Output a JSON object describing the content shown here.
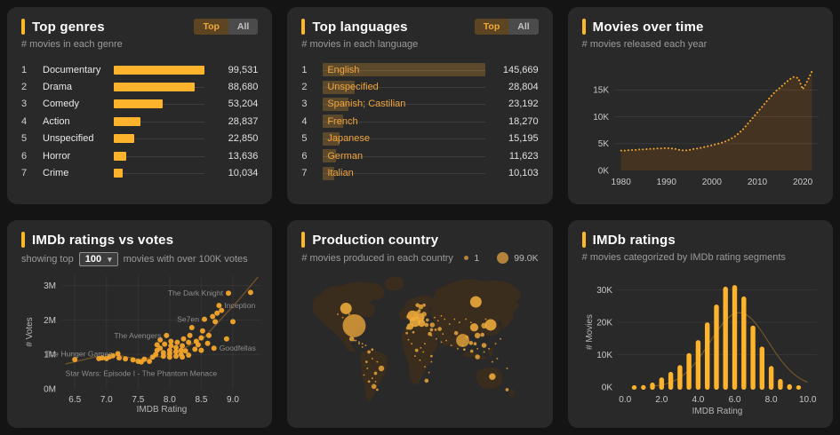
{
  "theme": {
    "accent": "#FDB827",
    "bar_orange": "#FDB32C",
    "orange_text": "#F2A53C",
    "panel_bg": "#292929",
    "page_bg": "#141414",
    "area_fill": "#443320",
    "trend_brown": "#84602B",
    "map_land": "#3A2D1E",
    "bubble": "#E2A13A",
    "tick_text": "#c9c9c9",
    "annotation_text": "#8d8d8d"
  },
  "panels": {
    "top_genres": {
      "title": "Top genres",
      "subtitle": "# movies in each genre",
      "toggle_top": "Top",
      "toggle_all": "All"
    },
    "top_languages": {
      "title": "Top languages",
      "subtitle": "# movies in each language",
      "toggle_top": "Top",
      "toggle_all": "All"
    },
    "movies_over_time": {
      "title": "Movies over time",
      "subtitle": "# movies released each year"
    },
    "ratings_vs_votes": {
      "title": "IMDb ratings vs votes",
      "subtitle_prefix": "showing top",
      "dropdown_value": "100",
      "subtitle_suffix": "movies with over 100K votes"
    },
    "production_country": {
      "title": "Production country",
      "subtitle": "# movies produced in each country",
      "legend_min": "1",
      "legend_max": "99.0K"
    },
    "imdb_ratings": {
      "title": "IMDb ratings",
      "subtitle": "# movies categorized by IMDb rating segments"
    }
  },
  "chart_data": [
    {
      "id": "top_genres",
      "type": "bar",
      "orientation": "horizontal",
      "title": "Top genres",
      "categories": [
        "Documentary",
        "Drama",
        "Comedy",
        "Action",
        "Unspecified",
        "Horror",
        "Crime"
      ],
      "values": [
        99531,
        88680,
        53204,
        28837,
        22850,
        13636,
        10034
      ],
      "value_labels": [
        "99,531",
        "88,680",
        "53,204",
        "28,837",
        "22,850",
        "13,636",
        "10,034"
      ]
    },
    {
      "id": "top_languages",
      "type": "bar",
      "orientation": "horizontal",
      "title": "Top languages",
      "categories": [
        "English",
        "Unspecified",
        "Spanish; Castilian",
        "French",
        "Japanese",
        "German",
        "Italian"
      ],
      "values": [
        145669,
        28804,
        23192,
        18270,
        15195,
        11623,
        10103
      ],
      "value_labels": [
        "145,669",
        "28,804",
        "23,192",
        "18,270",
        "15,195",
        "11,623",
        "10,103"
      ]
    },
    {
      "id": "movies_over_time",
      "type": "area",
      "title": "Movies over time",
      "x": [
        1980,
        1981,
        1982,
        1983,
        1984,
        1985,
        1986,
        1987,
        1988,
        1989,
        1990,
        1991,
        1992,
        1993,
        1994,
        1995,
        1996,
        1997,
        1998,
        1999,
        2000,
        2001,
        2002,
        2003,
        2004,
        2005,
        2006,
        2007,
        2008,
        2009,
        2010,
        2011,
        2012,
        2013,
        2014,
        2015,
        2016,
        2017,
        2018,
        2019,
        2020,
        2021,
        2022
      ],
      "y_thousands": [
        3.7,
        3.7,
        3.8,
        3.8,
        3.9,
        3.9,
        4.0,
        4.0,
        4.1,
        4.1,
        4.2,
        4.1,
        4.0,
        3.8,
        3.7,
        3.8,
        4.0,
        4.1,
        4.3,
        4.5,
        4.7,
        4.9,
        5.1,
        5.4,
        5.8,
        6.3,
        7.0,
        7.8,
        8.8,
        9.8,
        10.8,
        11.8,
        12.8,
        13.8,
        14.7,
        15.4,
        16.2,
        16.9,
        17.4,
        17.2,
        15.1,
        16.6,
        18.4
      ],
      "ylim_thousands": [
        0,
        19.5
      ],
      "yticks": [
        0,
        5,
        10,
        15
      ],
      "ytick_labels": [
        "0K",
        "5K",
        "10K",
        "15K"
      ],
      "xticks": [
        1980,
        1990,
        2000,
        2010,
        2020
      ],
      "xtick_labels": [
        "1980",
        "1990",
        "2000",
        "2010",
        "2020"
      ],
      "line_style": "dotted"
    },
    {
      "id": "ratings_vs_votes",
      "type": "scatter",
      "title": "IMDb ratings vs votes",
      "xlabel": "IMDB Rating",
      "ylabel": "# Votes",
      "xlim": [
        6.3,
        9.45
      ],
      "ylim_millions": [
        0,
        3.3
      ],
      "xticks": [
        6.5,
        7.0,
        7.5,
        8.0,
        8.5,
        9.0
      ],
      "xtick_labels": [
        "6.5",
        "7.0",
        "7.5",
        "8.0",
        "8.5",
        "9.0"
      ],
      "yticks": [
        0,
        1,
        2,
        3
      ],
      "ytick_labels": [
        "0M",
        "1M",
        "2M",
        "3M"
      ],
      "points": [
        [
          6.5,
          0.85
        ],
        [
          6.88,
          0.88
        ],
        [
          6.93,
          0.9
        ],
        [
          7.0,
          0.88
        ],
        [
          7.05,
          0.93
        ],
        [
          7.1,
          0.96
        ],
        [
          7.18,
          1.02
        ],
        [
          7.2,
          0.9
        ],
        [
          7.3,
          0.87
        ],
        [
          7.42,
          0.84
        ],
        [
          7.5,
          0.8
        ],
        [
          7.55,
          0.78
        ],
        [
          7.6,
          0.86
        ],
        [
          7.68,
          0.8
        ],
        [
          7.73,
          0.92
        ],
        [
          7.78,
          1.0
        ],
        [
          7.8,
          1.12
        ],
        [
          7.8,
          1.28
        ],
        [
          7.85,
          1.42
        ],
        [
          7.85,
          1.18
        ],
        [
          7.9,
          0.95
        ],
        [
          7.9,
          1.05
        ],
        [
          7.92,
          1.3
        ],
        [
          7.95,
          1.55
        ],
        [
          8.0,
          0.92
        ],
        [
          8.0,
          1.02
        ],
        [
          8.0,
          1.12
        ],
        [
          8.02,
          1.25
        ],
        [
          8.02,
          1.38
        ],
        [
          8.1,
          0.95
        ],
        [
          8.1,
          1.08
        ],
        [
          8.1,
          1.2
        ],
        [
          8.12,
          1.35
        ],
        [
          8.18,
          1.0
        ],
        [
          8.18,
          1.12
        ],
        [
          8.2,
          0.92
        ],
        [
          8.2,
          1.25
        ],
        [
          8.22,
          1.45
        ],
        [
          8.25,
          1.1
        ],
        [
          8.3,
          0.98
        ],
        [
          8.3,
          1.35
        ],
        [
          8.32,
          1.55
        ],
        [
          8.35,
          1.78
        ],
        [
          8.4,
          1.15
        ],
        [
          8.42,
          1.38
        ],
        [
          8.45,
          1.28
        ],
        [
          8.5,
          1.12
        ],
        [
          8.5,
          1.48
        ],
        [
          8.52,
          1.68
        ],
        [
          8.55,
          2.02
        ],
        [
          8.6,
          1.32
        ],
        [
          8.62,
          1.55
        ],
        [
          8.68,
          2.1
        ],
        [
          8.7,
          1.18
        ],
        [
          8.72,
          1.95
        ],
        [
          8.75,
          2.2
        ],
        [
          8.78,
          2.42
        ],
        [
          8.82,
          2.28
        ],
        [
          8.9,
          1.45
        ],
        [
          8.93,
          2.78
        ],
        [
          9.0,
          1.95
        ],
        [
          9.28,
          2.8
        ]
      ],
      "annotations": [
        {
          "text": "The Dark Knight",
          "x": 8.93,
          "y": 2.78,
          "side": "left"
        },
        {
          "text": "Inception",
          "x": 8.78,
          "y": 2.42,
          "side": "right"
        },
        {
          "text": "Se7en",
          "x": 8.55,
          "y": 2.02,
          "side": "left"
        },
        {
          "text": "The Avengers",
          "x": 7.95,
          "y": 1.55,
          "side": "left"
        },
        {
          "text": "The Hunger Games",
          "x": 7.18,
          "y": 1.02,
          "side": "left"
        },
        {
          "text": "Goodfellas",
          "x": 8.7,
          "y": 1.18,
          "side": "right"
        },
        {
          "text": "Star Wars: Episode I - The Phantom Menace",
          "x": 7.55,
          "y": 0.78,
          "side": "below"
        }
      ],
      "trend": [
        [
          6.35,
          0.72
        ],
        [
          6.8,
          0.92
        ],
        [
          7.2,
          0.97
        ],
        [
          7.5,
          0.86
        ],
        [
          7.9,
          0.95
        ],
        [
          8.2,
          1.15
        ],
        [
          8.55,
          1.5
        ],
        [
          8.85,
          2.1
        ],
        [
          9.1,
          2.6
        ],
        [
          9.4,
          3.25
        ]
      ]
    },
    {
      "id": "production_country",
      "type": "bubble-map",
      "title": "Production country",
      "legend": {
        "min_label": "1",
        "max_label": "99.0K",
        "min_value": 1,
        "max_value": 99000
      },
      "bubbles": [
        [
          54,
          47,
          7
        ],
        [
          64,
          68,
          14
        ],
        [
          61,
          84,
          3
        ],
        [
          82,
          100,
          2
        ],
        [
          86,
          97,
          1.5
        ],
        [
          79,
          112,
          1.5
        ],
        [
          97,
          120,
          3.5
        ],
        [
          90,
          126,
          2
        ],
        [
          88,
          142,
          3
        ],
        [
          82,
          136,
          1.5
        ],
        [
          92,
          146,
          1.5
        ],
        [
          135,
          56,
          6.5
        ],
        [
          130,
          57,
          2.5
        ],
        [
          138,
          63,
          6.5
        ],
        [
          144,
          58,
          5.5
        ],
        [
          132,
          69,
          4
        ],
        [
          146,
          65,
          4.5
        ],
        [
          140,
          53,
          3
        ],
        [
          138,
          56,
          2
        ],
        [
          145,
          45,
          3
        ],
        [
          141,
          43,
          2.5
        ],
        [
          143,
          50,
          2
        ],
        [
          149,
          43,
          2
        ],
        [
          149,
          54,
          3
        ],
        [
          147,
          57,
          2
        ],
        [
          146,
          60,
          2
        ],
        [
          141,
          61,
          2
        ],
        [
          129,
          71,
          2
        ],
        [
          152,
          67,
          2.5
        ],
        [
          153,
          61,
          2
        ],
        [
          159,
          67,
          3
        ],
        [
          212,
          39,
          7
        ],
        [
          128,
          77,
          1.5
        ],
        [
          136,
          76,
          1.5
        ],
        [
          156,
          78,
          2.5
        ],
        [
          140,
          98,
          2
        ],
        [
          158,
          105,
          1.5
        ],
        [
          152,
          135,
          2.5
        ],
        [
          158,
          73,
          2
        ],
        [
          168,
          72,
          2.5
        ],
        [
          163,
          73,
          1.5
        ],
        [
          196,
          86,
          8
        ],
        [
          188,
          77,
          2.5
        ],
        [
          201,
          82,
          2
        ],
        [
          198,
          97,
          1.5
        ],
        [
          210,
          70,
          5
        ],
        [
          222,
          68,
          3.5
        ],
        [
          230,
          67,
          7
        ],
        [
          214,
          80,
          3.5
        ],
        [
          220,
          79,
          2.5
        ],
        [
          222,
          92,
          3
        ],
        [
          206,
          89,
          2.5
        ],
        [
          211,
          90,
          2
        ],
        [
          214,
          106,
          3
        ],
        [
          207,
          99,
          2
        ],
        [
          232,
          130,
          4
        ],
        [
          250,
          146,
          2
        ]
      ],
      "dots": [
        [
          130,
          85
        ],
        [
          134,
          90
        ],
        [
          145,
          95
        ],
        [
          150,
          90
        ],
        [
          138,
          105
        ],
        [
          144,
          110
        ],
        [
          150,
          118
        ],
        [
          155,
          125
        ],
        [
          148,
          100
        ],
        [
          158,
          112
        ],
        [
          86,
          108
        ],
        [
          92,
          112
        ],
        [
          80,
          120
        ],
        [
          86,
          132
        ],
        [
          90,
          136
        ],
        [
          76,
          128
        ],
        [
          174,
          60
        ],
        [
          180,
          66
        ],
        [
          186,
          60
        ],
        [
          192,
          64
        ],
        [
          200,
          60
        ],
        [
          206,
          64
        ],
        [
          224,
          60
        ],
        [
          172,
          78
        ],
        [
          176,
          86
        ],
        [
          182,
          92
        ],
        [
          190,
          96
        ],
        [
          196,
          92
        ],
        [
          214,
          96
        ],
        [
          222,
          100
        ],
        [
          228,
          96
        ],
        [
          236,
          90
        ],
        [
          242,
          84
        ],
        [
          232,
          112
        ],
        [
          238,
          108
        ],
        [
          250,
          120
        ],
        [
          44,
          54
        ],
        [
          50,
          58
        ],
        [
          58,
          54
        ],
        [
          70,
          90
        ],
        [
          64,
          86
        ],
        [
          74,
          94
        ],
        [
          162,
          58
        ],
        [
          166,
          62
        ],
        [
          170,
          56
        ],
        [
          158,
          80
        ],
        [
          164,
          84
        ],
        [
          170,
          88
        ],
        [
          66,
          86
        ],
        [
          70,
          88
        ],
        [
          74,
          90
        ],
        [
          78,
          92
        ]
      ]
    },
    {
      "id": "imdb_ratings",
      "type": "bar",
      "title": "IMDb ratings",
      "xlabel": "IMDB Rating",
      "ylabel": "# Movies",
      "categories": [
        0.5,
        1.0,
        1.5,
        2.0,
        2.5,
        3.0,
        3.5,
        4.0,
        4.5,
        5.0,
        5.5,
        6.0,
        6.5,
        7.0,
        7.5,
        8.0,
        8.5,
        9.0,
        9.5
      ],
      "values_thousands": [
        0.4,
        0.6,
        1.4,
        3.0,
        4.7,
        6.8,
        10.5,
        14.5,
        20,
        25.5,
        31,
        31.5,
        28,
        19,
        12.5,
        6.5,
        2.5,
        0.9,
        0.4
      ],
      "ylim_thousands": [
        0,
        34
      ],
      "yticks": [
        0,
        10,
        20,
        30
      ],
      "ytick_labels": [
        "0K",
        "10K",
        "20K",
        "30K"
      ],
      "xticks": [
        0,
        2,
        4,
        6,
        8,
        10
      ],
      "xtick_labels": [
        "0.0",
        "2.0",
        "4.0",
        "6.0",
        "8.0",
        "10.0"
      ],
      "curve": {
        "peak_thousands": 23,
        "mu": 6.25,
        "sigma": 1.6
      }
    }
  ]
}
